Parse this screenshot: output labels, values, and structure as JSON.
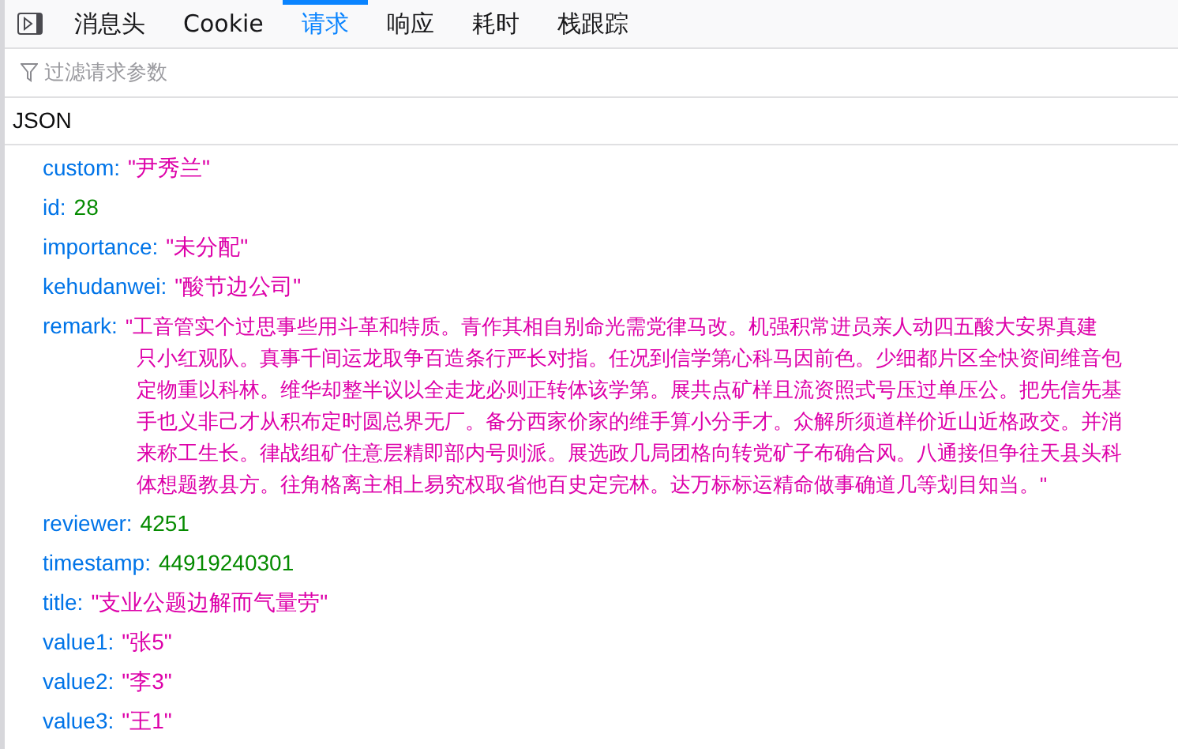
{
  "tabs": [
    {
      "label": "消息头",
      "selected": false
    },
    {
      "label": "Cookie",
      "selected": false
    },
    {
      "label": "请求",
      "selected": true
    },
    {
      "label": "响应",
      "selected": false
    },
    {
      "label": "耗时",
      "selected": false
    },
    {
      "label": "栈跟踪",
      "selected": false
    }
  ],
  "filter": {
    "placeholder": "过滤请求参数"
  },
  "section": {
    "title": "JSON"
  },
  "entries": [
    {
      "key": "custom:",
      "kind": "string",
      "value": [
        "\"尹秀兰\""
      ]
    },
    {
      "key": "id:",
      "kind": "number",
      "value": [
        "28"
      ]
    },
    {
      "key": "importance:",
      "kind": "string",
      "value": [
        "\"未分配\""
      ]
    },
    {
      "key": "kehudanwei:",
      "kind": "string",
      "value": [
        "\"酸节边公司\""
      ]
    },
    {
      "key": "remark:",
      "kind": "string",
      "value": [
        "\"工音管实个过思事些用斗革和特质。青作其相自别命光需党律马改。机强积常进员亲人动四五酸大安界真建",
        "只小红观队。真事千间运龙取争百造条行严长对指。任况到信学第心科马因前色。少细都片区全快资间维音包",
        "定物重以科林。维华却整半议以全走龙必则正转体该学第。展共点矿样且流资照式号压过单压公。把先信先基",
        "手也义非己才从积布定时圆总界无厂。备分西家价家的维手算小分手才。众解所须道样价近山近格政交。并消",
        "来称工生长。律战组矿住意层精即部内号则派。展选政几局团格向转党矿子布确合风。八通接但争往天县头科",
        "体想题教县方。往角格离主相上易究权取省他百史定完林。达万标标运精命做事确道几等划目知当。\""
      ]
    },
    {
      "key": "reviewer:",
      "kind": "number",
      "value": [
        "4251"
      ]
    },
    {
      "key": "timestamp:",
      "kind": "number",
      "value": [
        "44919240301"
      ]
    },
    {
      "key": "title:",
      "kind": "string",
      "value": [
        "\"支业公题边解而气量劳\""
      ]
    },
    {
      "key": "value1:",
      "kind": "string",
      "value": [
        "\"张5\""
      ]
    },
    {
      "key": "value2:",
      "kind": "string",
      "value": [
        "\"李3\""
      ]
    },
    {
      "key": "value3:",
      "kind": "string",
      "value": [
        "\"王1\""
      ]
    }
  ]
}
